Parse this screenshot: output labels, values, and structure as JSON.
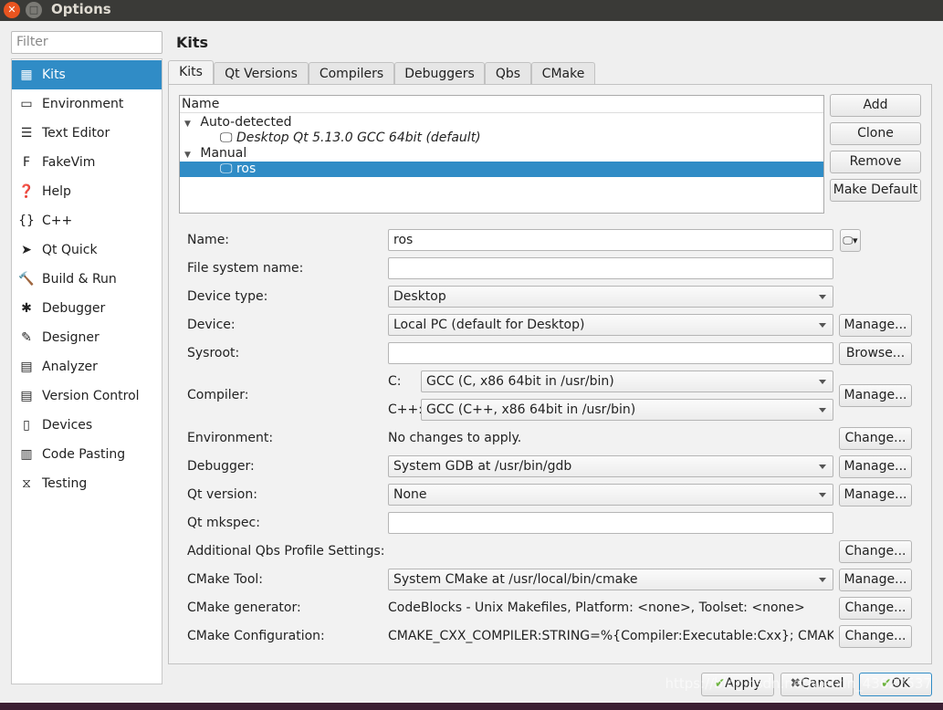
{
  "window": {
    "title": "Options"
  },
  "sidebar": {
    "filter_placeholder": "Filter",
    "items": [
      {
        "label": "Kits",
        "icon": "kits-icon"
      },
      {
        "label": "Environment",
        "icon": "monitor-icon"
      },
      {
        "label": "Text Editor",
        "icon": "text-editor-icon"
      },
      {
        "label": "FakeVim",
        "icon": "fakevim-icon"
      },
      {
        "label": "Help",
        "icon": "help-icon"
      },
      {
        "label": "C++",
        "icon": "braces-icon"
      },
      {
        "label": "Qt Quick",
        "icon": "qt-quick-icon"
      },
      {
        "label": "Build & Run",
        "icon": "hammer-icon"
      },
      {
        "label": "Debugger",
        "icon": "bug-icon"
      },
      {
        "label": "Designer",
        "icon": "pencil-icon"
      },
      {
        "label": "Analyzer",
        "icon": "analyzer-icon"
      },
      {
        "label": "Version Control",
        "icon": "version-control-icon"
      },
      {
        "label": "Devices",
        "icon": "devices-icon"
      },
      {
        "label": "Code Pasting",
        "icon": "code-pasting-icon"
      },
      {
        "label": "Testing",
        "icon": "testing-icon"
      }
    ]
  },
  "page": {
    "title": "Kits",
    "tabs": [
      "Kits",
      "Qt Versions",
      "Compilers",
      "Debuggers",
      "Qbs",
      "CMake"
    ]
  },
  "tree": {
    "header": "Name",
    "groups": [
      {
        "label": "Auto-detected",
        "items": [
          "Desktop Qt 5.13.0 GCC 64bit (default)"
        ]
      },
      {
        "label": "Manual",
        "items": [
          "ros"
        ]
      }
    ]
  },
  "kit_buttons": {
    "add": "Add",
    "clone": "Clone",
    "remove": "Remove",
    "make_default": "Make Default"
  },
  "form": {
    "name_label": "Name:",
    "name_value": "ros",
    "fs_label": "File system name:",
    "fs_value": "",
    "device_type_label": "Device type:",
    "device_type_value": "Desktop",
    "device_label": "Device:",
    "device_value": "Local PC (default for Desktop)",
    "sysroot_label": "Sysroot:",
    "sysroot_value": "",
    "compiler_label": "Compiler:",
    "c_label": "C:",
    "c_value": "GCC (C, x86 64bit in /usr/bin)",
    "cpp_label": "C++:",
    "cpp_value": "GCC (C++, x86 64bit in /usr/bin)",
    "env_label": "Environment:",
    "env_value": "No changes to apply.",
    "debugger_label": "Debugger:",
    "debugger_value": "System GDB at /usr/bin/gdb",
    "qt_version_label": "Qt version:",
    "qt_version_value": "None",
    "mkspec_label": "Qt mkspec:",
    "mkspec_value": "",
    "qbs_label": "Additional Qbs Profile Settings:",
    "cmake_tool_label": "CMake Tool:",
    "cmake_tool_value": "System CMake at /usr/local/bin/cmake",
    "cmake_gen_label": "CMake generator:",
    "cmake_gen_value": "CodeBlocks - Unix Makefiles, Platform: <none>, Toolset: <none>",
    "cmake_conf_label": "CMake Configuration:",
    "cmake_conf_value": "CMAKE_CXX_COMPILER:STRING=%{Compiler:Executable:Cxx}; CMAK…",
    "manage": "Manage...",
    "browse": "Browse...",
    "change": "Change..."
  },
  "footer": {
    "apply": "Apply",
    "cancel": "Cancel",
    "ok": "OK"
  },
  "watermark": "https://blog.csdn.net/weixin_43622537",
  "colors": {
    "selection": "#308cc6",
    "titlebar": "#3a3a37",
    "close": "#e95420"
  }
}
